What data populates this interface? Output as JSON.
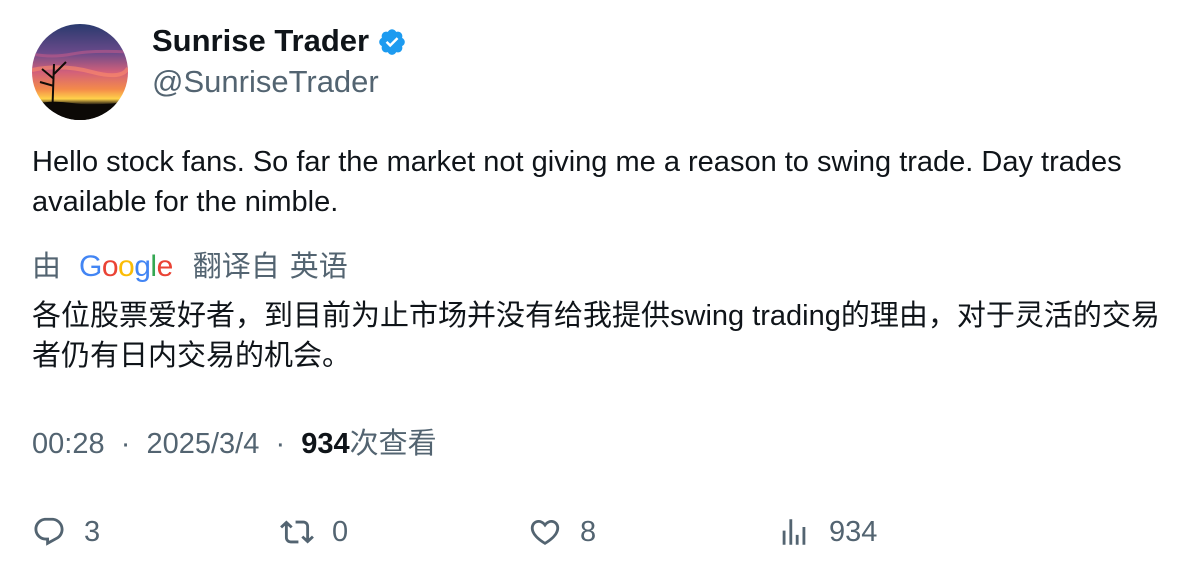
{
  "author": {
    "display_name": "Sunrise Trader",
    "handle": "@SunriseTrader",
    "verified_icon": "verified-badge-icon",
    "avatar_icon": "sunrise-landscape-avatar"
  },
  "tweet": {
    "text": "Hello stock fans.  So far the market not giving me a reason to swing trade. Day trades available for the nimble."
  },
  "translation": {
    "by_label": "由",
    "provider": "Google",
    "translated_from_label": "翻译自",
    "source_language": "英语",
    "text": "各位股票爱好者，到目前为止市场并没有给我提供swing trading的理由，对于灵活的交易者仍有日内交易的机会。"
  },
  "meta": {
    "time": "00:28",
    "separator": "·",
    "date": "2025/3/4",
    "views_count": "934",
    "views_label": "次查看"
  },
  "actions": {
    "reply_count": "3",
    "retweet_count": "0",
    "like_count": "8",
    "views_count": "934"
  },
  "colors": {
    "text_primary": "#0f1419",
    "text_secondary": "#536471",
    "verified_blue": "#1d9bf0",
    "google_blue": "#4285F4",
    "google_red": "#EA4335",
    "google_yellow": "#FBBC05",
    "google_green": "#34A853"
  }
}
